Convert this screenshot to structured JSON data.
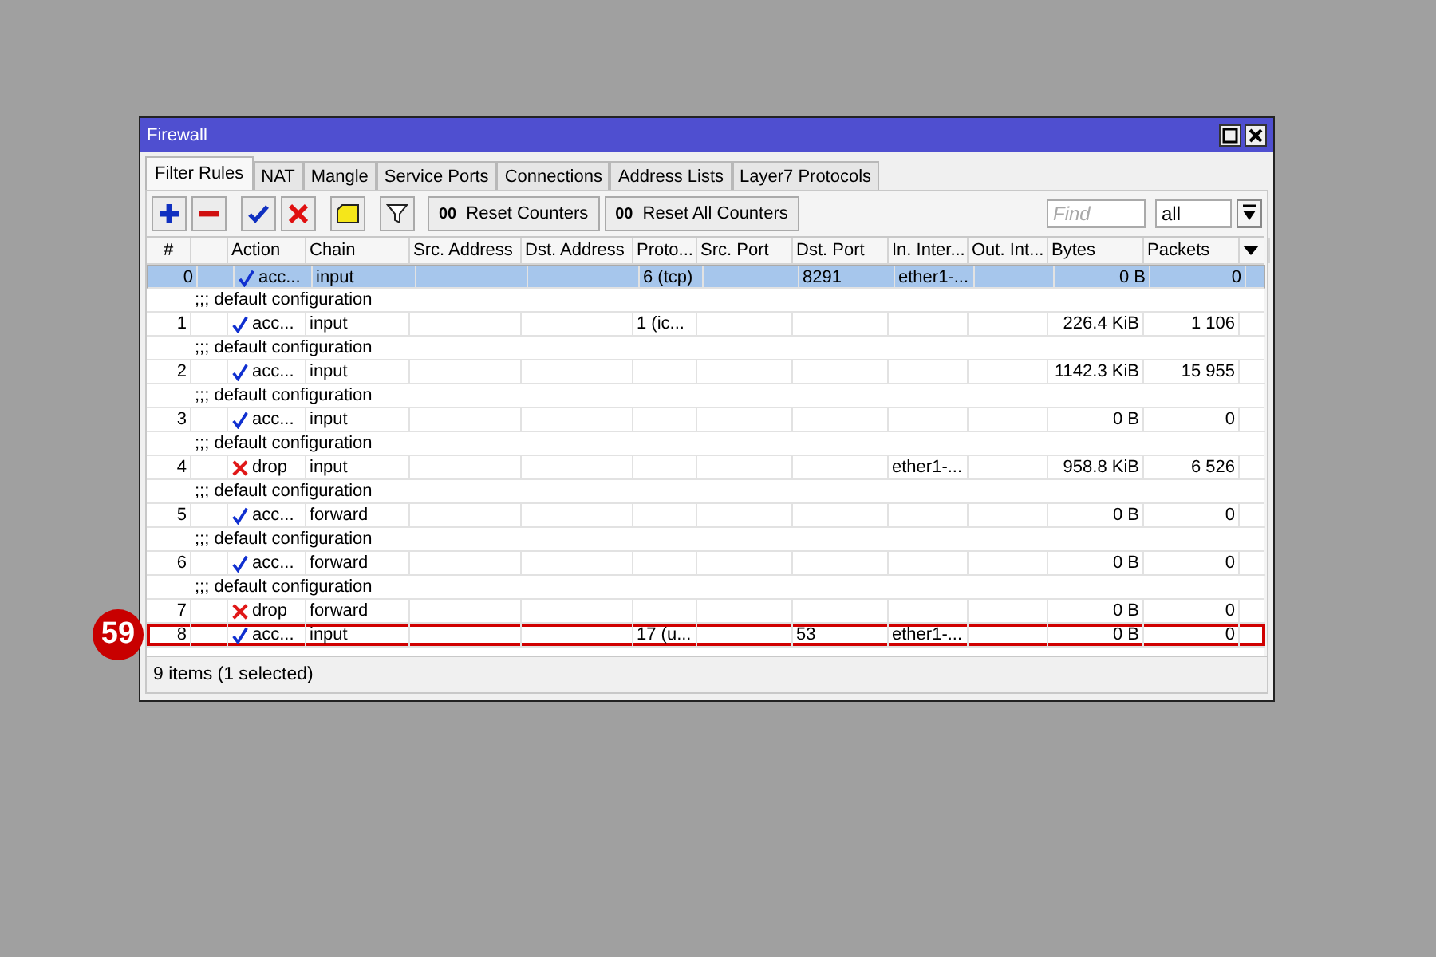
{
  "window": {
    "title": "Firewall"
  },
  "tabs": [
    {
      "label": "Filter Rules",
      "selected": true
    },
    {
      "label": "NAT",
      "selected": false
    },
    {
      "label": "Mangle",
      "selected": false
    },
    {
      "label": "Service Ports",
      "selected": false
    },
    {
      "label": "Connections",
      "selected": false
    },
    {
      "label": "Address Lists",
      "selected": false
    },
    {
      "label": "Layer7 Protocols",
      "selected": false
    }
  ],
  "toolbar": {
    "tools": [
      {
        "kind": "add"
      },
      {
        "kind": "remove"
      },
      {
        "kind": "enable"
      },
      {
        "kind": "disable"
      },
      {
        "kind": "comment"
      },
      {
        "kind": "filter"
      }
    ],
    "buttons": [
      {
        "icon_text": "00",
        "label": "Reset Counters"
      },
      {
        "icon_text": "00",
        "label": "Reset All Counters"
      }
    ],
    "search": {
      "placeholder": "Find"
    },
    "filter_select": {
      "value": "all"
    }
  },
  "table": {
    "columns": [
      "#",
      "",
      "Action",
      "Chain",
      "Src. Address",
      "Dst. Address",
      "Proto...",
      "Src. Port",
      "Dst. Port",
      "In. Inter...",
      "Out. Int...",
      "Bytes",
      "Packets"
    ],
    "rows": [
      {
        "number": "0",
        "kind": "accept",
        "action": "acc...",
        "chain": "input",
        "protocol": "6 (tcp)",
        "dst_port": "8291",
        "in_interface": "ether1-...",
        "bytes": "0 B",
        "packets": "0",
        "selected": true
      },
      {
        "comment": ";;; default configuration",
        "number": "1",
        "kind": "accept",
        "action": "acc...",
        "chain": "input",
        "protocol": "1 (ic...",
        "bytes": "226.4 KiB",
        "packets": "1 106",
        "selected": false
      },
      {
        "comment": ";;; default configuration",
        "number": "2",
        "kind": "accept",
        "action": "acc...",
        "chain": "input",
        "bytes": "1142.3 KiB",
        "packets": "15 955",
        "selected": false
      },
      {
        "comment": ";;; default configuration",
        "number": "3",
        "kind": "accept",
        "action": "acc...",
        "chain": "input",
        "bytes": "0 B",
        "packets": "0",
        "selected": false
      },
      {
        "comment": ";;; default configuration",
        "number": "4",
        "kind": "drop",
        "action": "drop",
        "chain": "input",
        "in_interface": "ether1-...",
        "bytes": "958.8 KiB",
        "packets": "6 526",
        "selected": false
      },
      {
        "comment": ";;; default configuration",
        "number": "5",
        "kind": "accept",
        "action": "acc...",
        "chain": "forward",
        "bytes": "0 B",
        "packets": "0",
        "selected": false
      },
      {
        "comment": ";;; default configuration",
        "number": "6",
        "kind": "accept",
        "action": "acc...",
        "chain": "forward",
        "bytes": "0 B",
        "packets": "0",
        "selected": false
      },
      {
        "comment": ";;; default configuration",
        "number": "7",
        "kind": "drop",
        "action": "drop",
        "chain": "forward",
        "bytes": "0 B",
        "packets": "0",
        "selected": false
      },
      {
        "number": "8",
        "kind": "accept",
        "action": "acc...",
        "chain": "input",
        "protocol": "17 (u...",
        "dst_port": "53",
        "in_interface": "ether1-...",
        "bytes": "0 B",
        "packets": "0",
        "selected": false,
        "callout": "59"
      }
    ]
  },
  "status_bar": "9 items (1 selected)"
}
